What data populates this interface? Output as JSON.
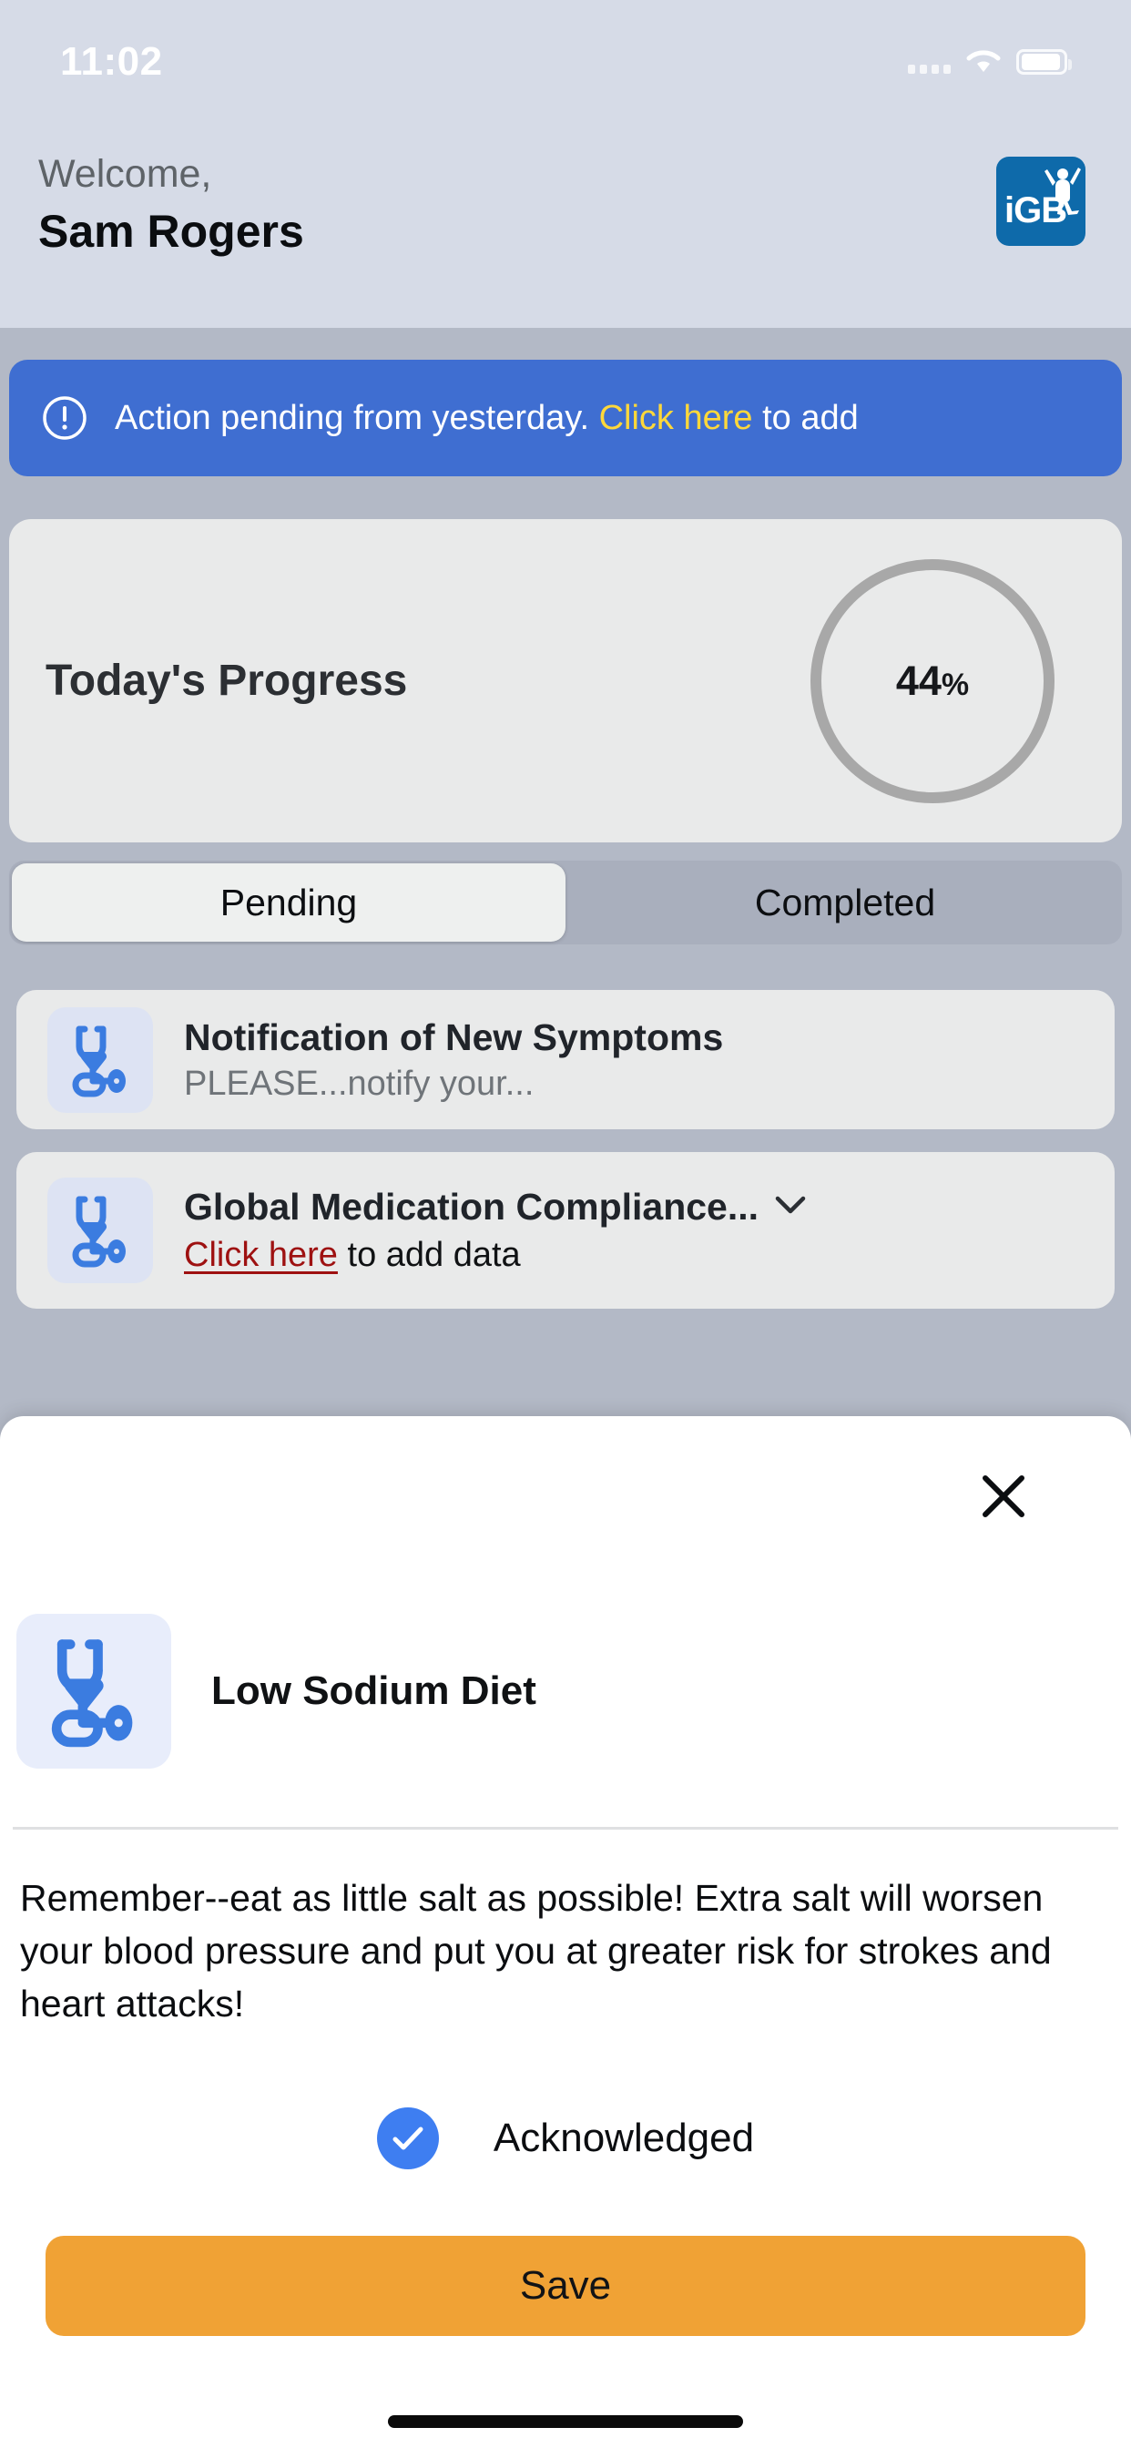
{
  "status_bar": {
    "time": "11:02",
    "signal_icon": "signal-dots-icon",
    "wifi_icon": "wifi-icon",
    "battery_icon": "battery-icon"
  },
  "header": {
    "welcome_label": "Welcome,",
    "user_name": "Sam Rogers",
    "logo_text": "iGB",
    "logo_color": "#0e6aaa"
  },
  "alert": {
    "text_before": "Action pending from yesterday.",
    "link_text": "Click here",
    "text_after": "to add",
    "icon": "exclamation-circle-icon",
    "background_color": "#3f6ed1",
    "link_color": "#ffd83a"
  },
  "progress": {
    "title": "Today's Progress",
    "value": 44,
    "value_text": "44",
    "unit": "%",
    "ring_color": "#a8a8a8"
  },
  "tabs": {
    "items": [
      {
        "label": "Pending",
        "active": true
      },
      {
        "label": "Completed",
        "active": false
      }
    ]
  },
  "tasks": [
    {
      "icon": "stethoscope-icon",
      "title": "Notification of New Symptoms",
      "subtitle": "PLEASE...notify your...",
      "has_chevron": false
    },
    {
      "icon": "stethoscope-icon",
      "title": "Global Medication Compliance...",
      "link_text": "Click here",
      "subtitle_after": "to add data",
      "has_chevron": true,
      "link_color": "#9e1111"
    }
  ],
  "sheet": {
    "close_icon": "close-icon",
    "icon": "stethoscope-icon",
    "title": "Low Sodium Diet",
    "body": "Remember--eat as little salt as possible! Extra salt will worsen your blood pressure and put you at greater risk for strokes and heart attacks!",
    "acknowledge": {
      "label": "Acknowledged",
      "checked": true,
      "check_color": "#3e7ef1"
    },
    "save_label": "Save",
    "save_color": "#f0a235"
  }
}
